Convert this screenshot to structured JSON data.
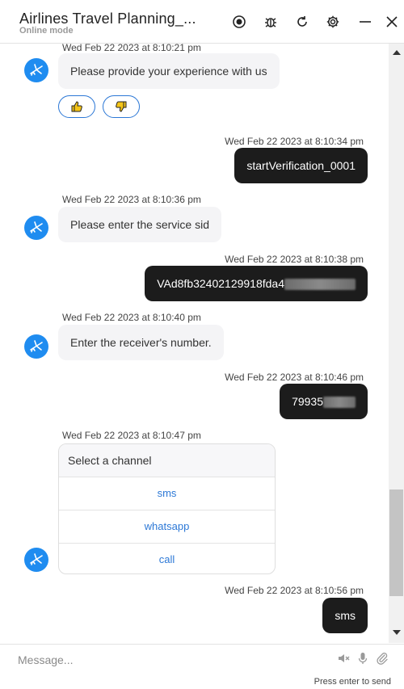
{
  "header": {
    "title": "Airlines Travel Planning_...",
    "subtitle": "Online mode"
  },
  "messages": {
    "m1": {
      "timestamp": "Wed Feb 22 2023 at 8:10:21 pm",
      "text": "Please provide your experience with us"
    },
    "m2": {
      "timestamp": "Wed Feb 22 2023 at 8:10:34 pm",
      "text": "startVerification_0001"
    },
    "m3": {
      "timestamp": "Wed Feb 22 2023 at 8:10:36 pm",
      "text": "Please enter the service sid"
    },
    "m4": {
      "timestamp": "Wed Feb 22 2023 at 8:10:38 pm",
      "text": "VAd8fb32402129918fda4"
    },
    "m5": {
      "timestamp": "Wed Feb 22 2023 at 8:10:40 pm",
      "text": "Enter the receiver's number."
    },
    "m6": {
      "timestamp": "Wed Feb 22 2023 at 8:10:46 pm",
      "text": "79935"
    },
    "m7": {
      "timestamp": "Wed Feb 22 2023 at 8:10:47 pm",
      "heading": "Select a channel",
      "options": [
        "sms",
        "whatsapp",
        "call"
      ]
    },
    "m8": {
      "timestamp": "Wed Feb 22 2023 at 8:10:56 pm",
      "text": "sms"
    }
  },
  "composer": {
    "placeholder": "Message...",
    "hint": "Press enter to send"
  },
  "icons": {
    "header": [
      "record-icon",
      "bug-icon",
      "refresh-icon",
      "settings-icon",
      "minimize-icon",
      "close-icon"
    ],
    "message": [
      "thumbs-up-icon",
      "thumbs-down-icon",
      "bot-avatar-icon"
    ],
    "composer": [
      "speaker-muted-icon",
      "microphone-icon",
      "attachment-icon"
    ]
  },
  "colors": {
    "accent": "#2c78d6",
    "avatar": "#1f8cf0",
    "user_bubble": "#1c1c1c",
    "bot_bubble": "#f4f4f6"
  }
}
